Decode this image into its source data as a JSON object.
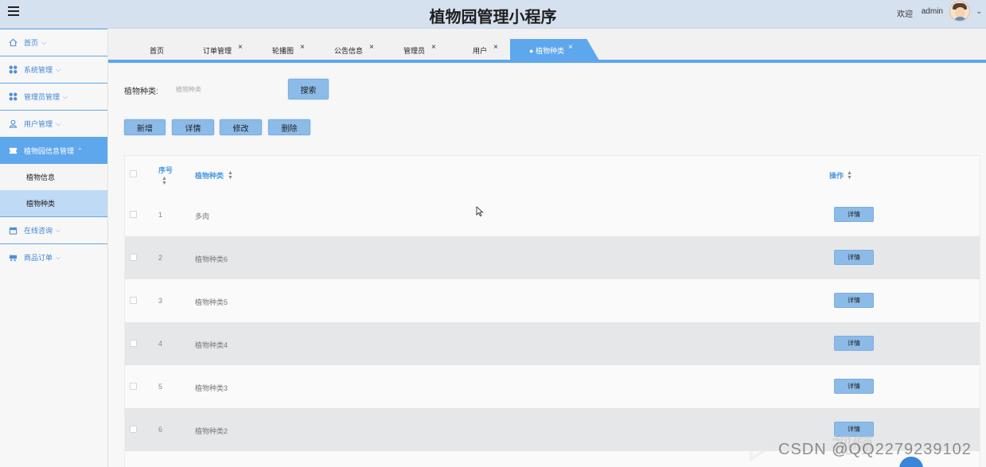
{
  "app": {
    "title": "植物园管理小程序",
    "welcome": "欢迎",
    "username": "admin"
  },
  "sidebar": {
    "items": [
      {
        "label": "首页",
        "icon": "home-icon"
      },
      {
        "label": "系统管理",
        "icon": "grid-icon"
      },
      {
        "label": "管理员管理",
        "icon": "grid-icon"
      },
      {
        "label": "用户管理",
        "icon": "user-icon"
      },
      {
        "label": "植物园信息管理",
        "icon": "ticket-icon",
        "active": true
      },
      {
        "label": "在线咨询",
        "icon": "store-icon"
      },
      {
        "label": "商品订单",
        "icon": "cart-icon"
      }
    ],
    "subitems": [
      {
        "label": "植物信息"
      },
      {
        "label": "植物种类",
        "selected": true
      }
    ]
  },
  "tabs": [
    {
      "label": "首页",
      "closable": false
    },
    {
      "label": "订单管理",
      "closable": true
    },
    {
      "label": "轮播图",
      "closable": true
    },
    {
      "label": "公告信息",
      "closable": true
    },
    {
      "label": "管理员",
      "closable": true
    },
    {
      "label": "用户",
      "closable": true
    },
    {
      "label": "植物种类",
      "closable": true,
      "active": true
    }
  ],
  "close_glyph": "×",
  "search": {
    "label": "植物种类:",
    "placeholder": "植物种类",
    "button": "搜索"
  },
  "toolbar": {
    "add": "新增",
    "detail": "详情",
    "edit": "修改",
    "delete": "删除"
  },
  "table": {
    "columns": {
      "index": "序号",
      "name": "植物种类",
      "action": "操作"
    },
    "rows": [
      {
        "index": "1",
        "name": "多肉",
        "action": "详情"
      },
      {
        "index": "2",
        "name": "植物种类6",
        "action": "详情"
      },
      {
        "index": "3",
        "name": "植物种类5",
        "action": "详情"
      },
      {
        "index": "4",
        "name": "植物种类4",
        "action": "详情"
      },
      {
        "index": "5",
        "name": "植物种类3",
        "action": "详情"
      },
      {
        "index": "6",
        "name": "植物种类2",
        "action": "详情"
      }
    ]
  },
  "watermark": {
    "text": "CSDN @QQ2279239102",
    "ghost": "视频"
  },
  "colors": {
    "accent": "#5ea7ec",
    "header_bg": "#d6e1f0",
    "button_bg": "#8cbbe8",
    "row_alt": "#e6e7e8"
  }
}
